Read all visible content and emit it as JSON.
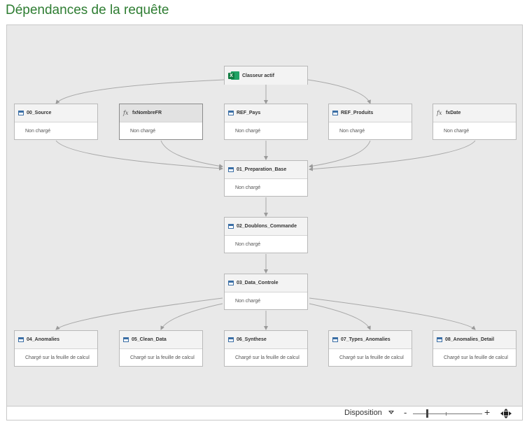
{
  "window": {
    "title": "Dépendances de la requête"
  },
  "root": {
    "name": "Classeur actif",
    "icon": "excel-icon"
  },
  "row1": [
    {
      "name": "00_Source",
      "status": "Non chargé",
      "icon": "table-icon"
    },
    {
      "name": "fxNombreFR",
      "status": "Non chargé",
      "icon": "function-icon",
      "selected": true
    },
    {
      "name": "REF_Pays",
      "status": "Non chargé",
      "icon": "table-icon"
    },
    {
      "name": "REF_Produits",
      "status": "Non chargé",
      "icon": "table-icon"
    },
    {
      "name": "fxDate",
      "status": "Non chargé",
      "icon": "function-icon"
    }
  ],
  "chain": [
    {
      "name": "01_Preparation_Base",
      "status": "Non chargé",
      "icon": "table-icon"
    },
    {
      "name": "02_Doublons_Commande",
      "status": "Non chargé",
      "icon": "table-icon"
    },
    {
      "name": "03_Data_Controle",
      "status": "Non chargé",
      "icon": "table-icon"
    }
  ],
  "outputs": [
    {
      "name": "04_Anomalies",
      "status": "Chargé sur la feuille de calcul",
      "icon": "table-icon"
    },
    {
      "name": "05_Clean_Data",
      "status": "Chargé sur la feuille de calcul",
      "icon": "table-icon"
    },
    {
      "name": "06_Synthese",
      "status": "Chargé sur la feuille de calcul",
      "icon": "table-icon"
    },
    {
      "name": "07_Types_Anomalies",
      "status": "Chargé sur la feuille de calcul",
      "icon": "table-icon"
    },
    {
      "name": "08_Anomalies_Detail",
      "status": "Chargé sur la feuille de calcul",
      "icon": "table-icon"
    }
  ],
  "statusbar": {
    "layout_label": "Disposition",
    "zoom_out": "-",
    "zoom_in": "+",
    "zoom_level": 0.2
  },
  "colors": {
    "title": "#2e7d32",
    "canvas": "#e9e9e9",
    "edge": "#9a9a9a",
    "table_icon": "#3a6ea5"
  }
}
